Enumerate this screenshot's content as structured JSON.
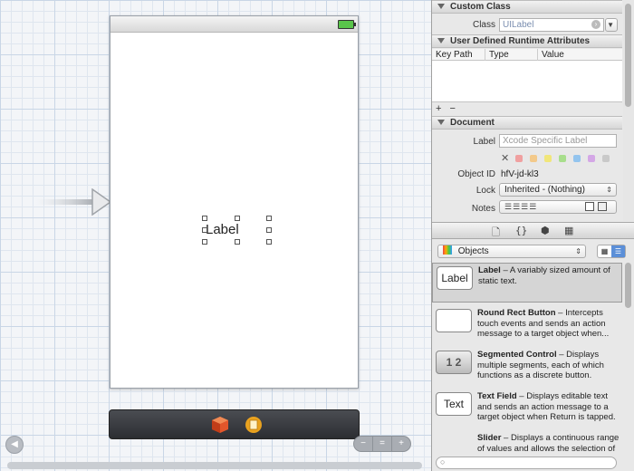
{
  "canvas": {
    "label_text": "Label",
    "dock_icons": [
      "first-responder-icon",
      "view-controller-icon"
    ],
    "zoom_controls": [
      "−",
      "=",
      "+"
    ]
  },
  "inspector": {
    "custom_class": {
      "title": "Custom Class",
      "class_label": "Class",
      "class_value": "UILabel"
    },
    "runtime_attrs": {
      "title": "User Defined Runtime Attributes",
      "columns": [
        "Key Path",
        "Type",
        "Value"
      ],
      "add": "+",
      "remove": "−"
    },
    "document": {
      "title": "Document",
      "label_label": "Label",
      "label_placeholder": "Xcode Specific Label",
      "object_id_label": "Object ID",
      "object_id_value": "hfV-jd-kl3",
      "lock_label": "Lock",
      "lock_value": "Inherited - (Nothing)",
      "notes_label": "Notes",
      "swatch_colors": [
        "#f0a0a0",
        "#f3c98a",
        "#f1e67a",
        "#a8de8c",
        "#93c4ee",
        "#d4a7e6",
        "#c9c9c9"
      ]
    },
    "library": {
      "dropdown_value": "Objects",
      "items": [
        {
          "icon": "Label",
          "name": "Label",
          "desc": " – A variably sized amount of static text."
        },
        {
          "icon": "",
          "name": "Round Rect Button",
          "desc": " – Intercepts touch events and sends an action message to a target object when..."
        },
        {
          "icon": "1 2",
          "name": "Segmented Control",
          "desc": " – Displays multiple segments, each of which functions as a discrete button."
        },
        {
          "icon": "Text",
          "name": "Text Field",
          "desc": " – Displays editable text and sends an action message to a target object when Return is tapped."
        },
        {
          "icon": "",
          "name": "Slider",
          "desc": " – Displays a continuous range of values and allows the selection of"
        }
      ]
    }
  }
}
